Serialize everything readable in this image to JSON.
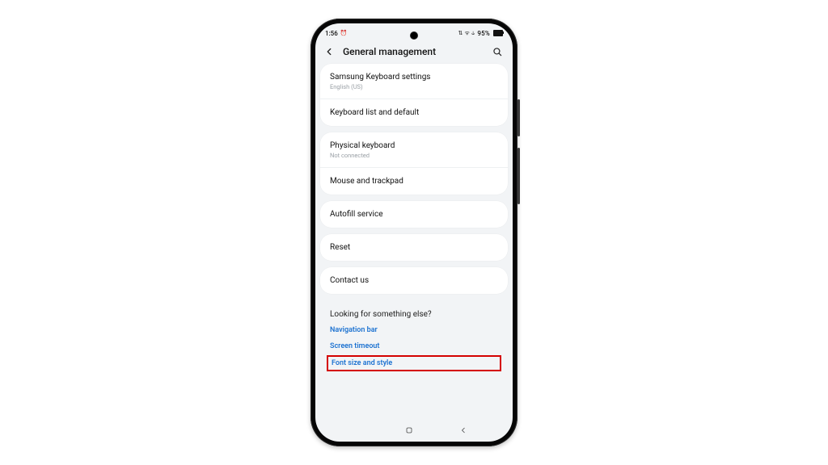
{
  "statusbar": {
    "time": "1:56",
    "alarm_glyph": "⏰",
    "net_glyphs": "⇅ ᯤ ⫝",
    "battery_pct": "95%"
  },
  "header": {
    "title": "General management"
  },
  "groups": [
    {
      "rows": [
        {
          "name": "samsung-keyboard",
          "title": "Samsung Keyboard settings",
          "sub": "English (US)"
        },
        {
          "name": "keyboard-list",
          "title": "Keyboard list and default"
        }
      ]
    },
    {
      "rows": [
        {
          "name": "physical-keyboard",
          "title": "Physical keyboard",
          "sub": "Not connected"
        },
        {
          "name": "mouse-trackpad",
          "title": "Mouse and trackpad"
        }
      ]
    },
    {
      "rows": [
        {
          "name": "autofill-service",
          "title": "Autofill service"
        }
      ]
    },
    {
      "rows": [
        {
          "name": "reset",
          "title": "Reset"
        }
      ]
    },
    {
      "rows": [
        {
          "name": "contact-us",
          "title": "Contact us"
        }
      ]
    }
  ],
  "suggest": {
    "heading": "Looking for something else?",
    "links": [
      {
        "name": "navigation-bar",
        "label": "Navigation bar",
        "highlight": false
      },
      {
        "name": "screen-timeout",
        "label": "Screen timeout",
        "highlight": false
      },
      {
        "name": "font-size-style",
        "label": "Font size and style",
        "highlight": true
      }
    ]
  }
}
